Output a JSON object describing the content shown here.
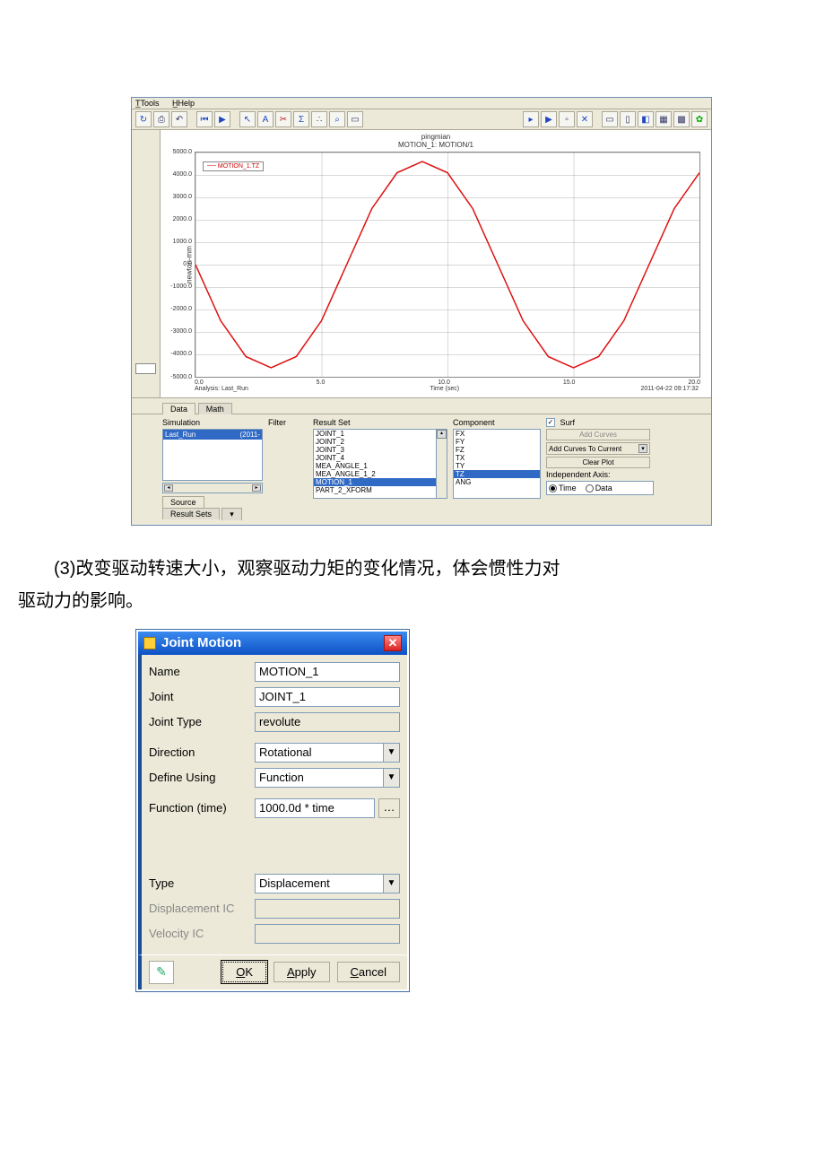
{
  "menubar": {
    "tools": "Tools",
    "help": "Help"
  },
  "chart_data": {
    "type": "line",
    "title_top": "pingmian",
    "title_sub": "MOTION_1: MOTION/1",
    "xlabel": "Time (sec)",
    "ylabel": "newton-mm",
    "xlim": [
      0,
      20
    ],
    "ylim": [
      -5000,
      5000
    ],
    "xticks": [
      "0.0",
      "5.0",
      "10.0",
      "15.0",
      "20.0"
    ],
    "yticks": [
      "5000.0",
      "4000.0",
      "3000.0",
      "2000.0",
      "1000.0",
      "0.0",
      "-1000.0",
      "-2000.0",
      "-3000.0",
      "-4000.0",
      "-5000.0"
    ],
    "series": [
      {
        "name": "MOTION_1.TZ",
        "color": "#d11",
        "x": [
          0,
          1,
          2,
          3,
          4,
          5,
          6,
          7,
          8,
          9,
          10,
          11,
          12,
          13,
          14,
          15,
          16,
          17,
          18,
          19,
          20
        ],
        "y": [
          0,
          -2500,
          -4100,
          -4600,
          -4100,
          -2500,
          0,
          2500,
          4100,
          4600,
          4100,
          2500,
          0,
          -2500,
          -4100,
          -4600,
          -4100,
          -2500,
          0,
          2500,
          4100
        ]
      }
    ],
    "footer_left": "Analysis: Last_Run",
    "footer_right": "2011-04-22 09:17:32"
  },
  "tabs": {
    "data": "Data",
    "math": "Math"
  },
  "panels": {
    "simulation": {
      "hdr": "Simulation",
      "row_name": "Last_Run",
      "row_date": "(2011-",
      "src": "Source",
      "rsets": "Result Sets"
    },
    "filter": {
      "hdr": "Filter"
    },
    "result_set": {
      "hdr": "Result Set",
      "items": [
        "JOINT_1",
        "JOINT_2",
        "JOINT_3",
        "JOINT_4",
        "MEA_ANGLE_1",
        "MEA_ANGLE_1_2",
        "MOTION_1",
        "PART_2_XFORM"
      ],
      "selected": "MOTION_1"
    },
    "component": {
      "hdr": "Component",
      "items": [
        "FX",
        "FY",
        "FZ",
        "TX",
        "TY",
        "TZ",
        "ANG"
      ],
      "selected": "TZ"
    },
    "right": {
      "surf": "Surf",
      "add": "Add Curves",
      "add_current": "Add Curves To Current",
      "clear": "Clear Plot",
      "indep": "Independent Axis:",
      "time": "Time",
      "data": "Data"
    }
  },
  "body_text": {
    "line1": "(3)改变驱动转速大小，观察驱动力矩的变化情况，体会惯性力对",
    "line2": "驱动力的影响。"
  },
  "dialog": {
    "title": "Joint Motion",
    "rows": {
      "name_l": "Name",
      "name_v": "MOTION_1",
      "joint_l": "Joint",
      "joint_v": "JOINT_1",
      "jtype_l": "Joint Type",
      "jtype_v": "revolute",
      "dir_l": "Direction",
      "dir_v": "Rotational",
      "def_l": "Define Using",
      "def_v": "Function",
      "fun_l": "Function (time)",
      "fun_v": "1000.0d * time",
      "type_l": "Type",
      "type_v": "Displacement",
      "disp_l": "Displacement IC",
      "vel_l": "Velocity IC"
    },
    "buttons": {
      "ok": "OK",
      "apply": "Apply",
      "cancel": "Cancel"
    }
  }
}
